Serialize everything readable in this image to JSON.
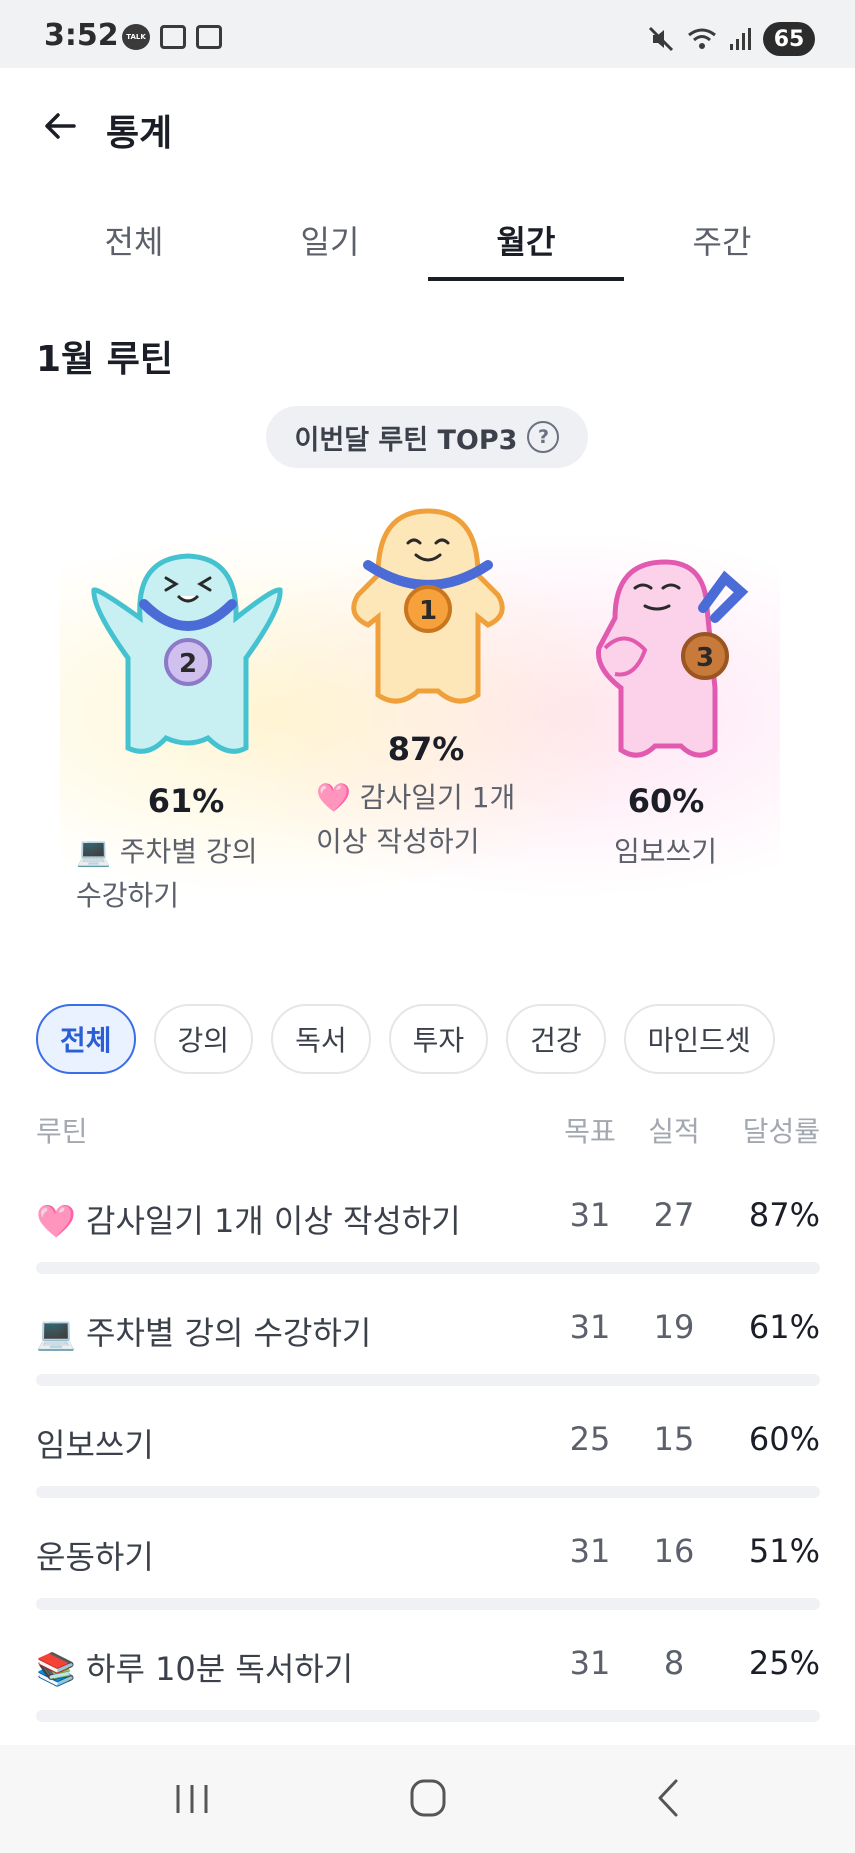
{
  "status_bar": {
    "time": "3:52",
    "talk_badge": "TALK",
    "battery": "65"
  },
  "header": {
    "title": "통계"
  },
  "tabs": [
    {
      "label": "전체",
      "active": false
    },
    {
      "label": "일기",
      "active": false
    },
    {
      "label": "월간",
      "active": true
    },
    {
      "label": "주간",
      "active": false
    }
  ],
  "section": {
    "title": "1월 루틴"
  },
  "top3": {
    "label": "이번달 루틴 TOP3",
    "help": "?",
    "first": {
      "rank": "1",
      "percent": "87%",
      "name_line1": "🩷 감사일기 1개",
      "name_line2": "이상 작성하기",
      "color": "#f5a431"
    },
    "second": {
      "rank": "2",
      "percent": "61%",
      "name_line1": "💻 주차별 강의",
      "name_line2": "수강하기",
      "color": "#52c4d1"
    },
    "third": {
      "rank": "3",
      "percent": "60%",
      "name_line1": "임보쓰기",
      "color": "#e25aaf"
    }
  },
  "filters": [
    "전체",
    "강의",
    "독서",
    "투자",
    "건강",
    "마인드셋"
  ],
  "table": {
    "headers": {
      "routine": "루틴",
      "goal": "목표",
      "actual": "실적",
      "rate": "달성률"
    },
    "rows": [
      {
        "name": "🩷 감사일기 1개 이상 작성하기",
        "goal": "31",
        "actual": "27",
        "rate": "87%"
      },
      {
        "name": "💻 주차별 강의 수강하기",
        "goal": "31",
        "actual": "19",
        "rate": "61%"
      },
      {
        "name": "임보쓰기",
        "goal": "25",
        "actual": "15",
        "rate": "60%"
      },
      {
        "name": "운동하기",
        "goal": "31",
        "actual": "16",
        "rate": "51%"
      },
      {
        "name": "📚 하루 10분 독서하기",
        "goal": "31",
        "actual": "8",
        "rate": "25%"
      }
    ]
  },
  "colors": {
    "accent": "#3a6ee8",
    "text_primary": "#1b1e27",
    "text_secondary": "#5b606b",
    "muted": "#a3a7b0"
  }
}
